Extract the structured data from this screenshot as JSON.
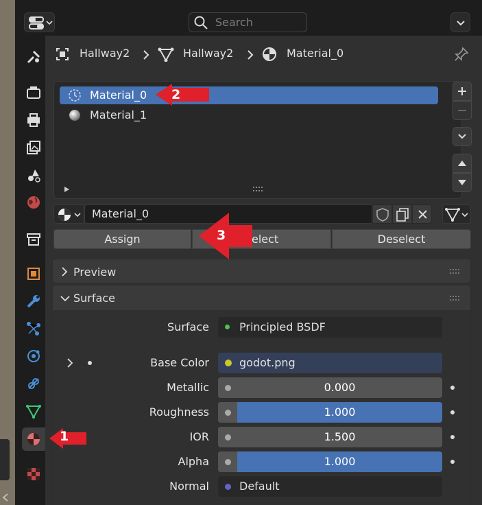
{
  "header": {
    "search_placeholder": "Search"
  },
  "breadcrumb": {
    "object": "Hallway2",
    "mesh": "Hallway2",
    "material": "Material_0"
  },
  "material_slots": [
    {
      "label": "Material_0",
      "selected": true
    },
    {
      "label": "Material_1",
      "selected": false
    }
  ],
  "slot_field": {
    "value": "Material_0"
  },
  "buttons": {
    "assign": "Assign",
    "select": "Select",
    "deselect": "Deselect"
  },
  "sections": {
    "preview": "Preview",
    "surface": "Surface"
  },
  "props": {
    "surface": {
      "label": "Surface",
      "value": "Principled BSDF",
      "dot": "#4dc24d"
    },
    "base_color": {
      "label": "Base Color",
      "value": "godot.png",
      "dot": "#c8c829"
    },
    "metallic": {
      "label": "Metallic",
      "value": "0.000",
      "fraction": 0
    },
    "roughness": {
      "label": "Roughness",
      "value": "1.000",
      "fraction": 1
    },
    "ior": {
      "label": "IOR",
      "value": "1.500",
      "fraction": 0
    },
    "alpha": {
      "label": "Alpha",
      "value": "1.000",
      "fraction": 1
    },
    "normal": {
      "label": "Normal",
      "value": "Default",
      "dot": "#6363c7"
    }
  },
  "annotations": [
    "1",
    "2",
    "3"
  ],
  "colors": {
    "accent": "#4772b3",
    "annotation": "#e0202a"
  }
}
